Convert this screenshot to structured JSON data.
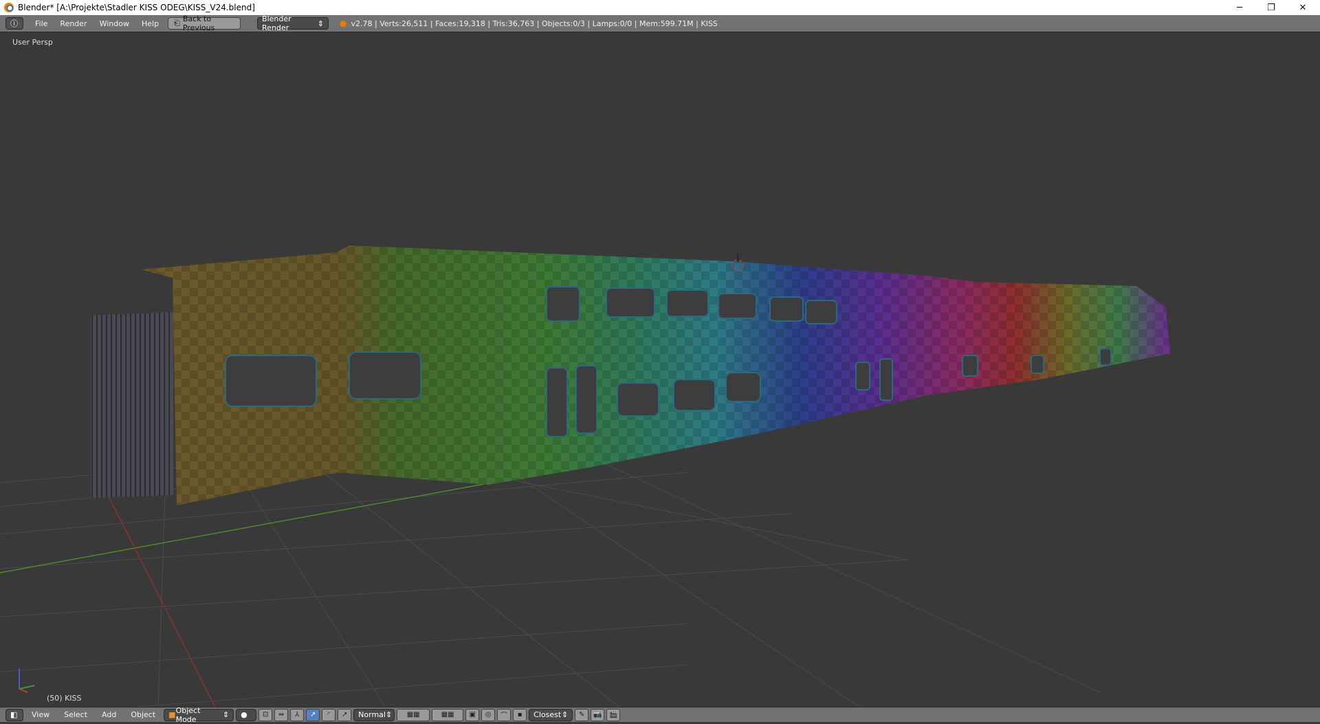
{
  "window": {
    "title": "Blender* [A:\\Projekte\\Stadler KISS ODEG\\KISS_V24.blend]",
    "minimize": "─",
    "restore": "❐",
    "close": "✕"
  },
  "menubar": {
    "menus": [
      "File",
      "Render",
      "Window",
      "Help"
    ],
    "back_button": "Back to Previous",
    "render_engine": "Blender Render",
    "stats": "v2.78 | Verts:26,511 | Faces:19,318 | Tris:36,763 | Objects:0/3 | Lamps:0/0 | Mem:599.71M | KISS"
  },
  "viewport": {
    "view_label": "User Persp",
    "object_label": "(50) KISS"
  },
  "footer": {
    "menus": [
      "View",
      "Select",
      "Add",
      "Object"
    ],
    "mode": "Object Mode",
    "pivot_orientation": "Normal",
    "snap_target": "Closest"
  },
  "colors": {
    "viewport_bg": "#393939",
    "header_bg": "#727272",
    "accent": "#5680c2"
  }
}
